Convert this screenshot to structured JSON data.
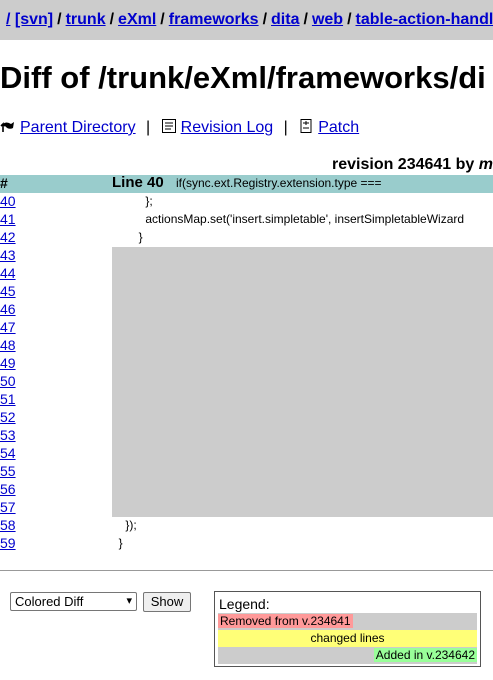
{
  "breadcrumbs": {
    "root": "/",
    "items": [
      "[svn]",
      "trunk",
      "eXml",
      "frameworks",
      "dita",
      "web",
      "table-action-handler"
    ],
    "separator": "/"
  },
  "title": "Diff of /trunk/eXml/frameworks/di",
  "nav": {
    "parent_directory": "Parent Directory",
    "revision_log": "Revision Log",
    "patch": "Patch",
    "pipe": "|"
  },
  "revision": {
    "text": "revision 234641 by",
    "by_name": "m"
  },
  "diff_header": {
    "hash": "#",
    "line_label": "Line 40",
    "context": "if(sync.ext.Registry.extension.type ==="
  },
  "rows": [
    {
      "num": "40",
      "code": "          };"
    },
    {
      "num": "41",
      "code": "          actionsMap.set('insert.simpletable', insertSimpletableWizard"
    },
    {
      "num": "42",
      "code": "        }"
    },
    {
      "num": "43",
      "code": ""
    },
    {
      "num": "44",
      "code": ""
    },
    {
      "num": "45",
      "code": ""
    },
    {
      "num": "46",
      "code": ""
    },
    {
      "num": "47",
      "code": ""
    },
    {
      "num": "48",
      "code": ""
    },
    {
      "num": "49",
      "code": ""
    },
    {
      "num": "50",
      "code": ""
    },
    {
      "num": "51",
      "code": ""
    },
    {
      "num": "52",
      "code": ""
    },
    {
      "num": "53",
      "code": ""
    },
    {
      "num": "54",
      "code": ""
    },
    {
      "num": "55",
      "code": ""
    },
    {
      "num": "56",
      "code": ""
    },
    {
      "num": "57",
      "code": ""
    },
    {
      "num": "58",
      "code": "    });"
    },
    {
      "num": "59",
      "code": "  }"
    }
  ],
  "controls": {
    "diff_format": "Colored Diff",
    "show_label": "Show"
  },
  "legend": {
    "title": "Legend:",
    "removed": "Removed from v.234641",
    "changed": "changed lines",
    "added": "Added in v.234642"
  },
  "colors": {
    "header_bg": "#99cccc",
    "removed": "#ff9999",
    "changed": "#ffff77",
    "added": "#99ff99",
    "gray": "#cccccc",
    "link": "#0000cc"
  }
}
